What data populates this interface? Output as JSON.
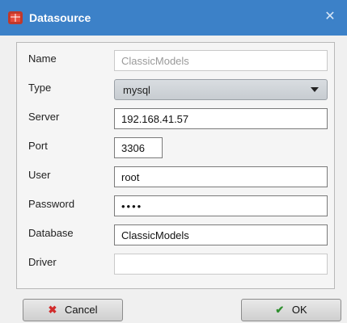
{
  "window": {
    "title": "Datasource"
  },
  "form": {
    "name": {
      "label": "Name",
      "value": "ClassicModels"
    },
    "type": {
      "label": "Type",
      "value": "mysql"
    },
    "server": {
      "label": "Server",
      "value": "192.168.41.57"
    },
    "port": {
      "label": "Port",
      "value": "3306"
    },
    "user": {
      "label": "User",
      "value": "root"
    },
    "password": {
      "label": "Password",
      "value": "••••"
    },
    "database": {
      "label": "Database",
      "value": "ClassicModels"
    },
    "driver": {
      "label": "Driver",
      "value": ""
    }
  },
  "buttons": {
    "cancel": "Cancel",
    "ok": "OK"
  },
  "icons": {
    "app": "database-icon",
    "close": "close-icon",
    "cancel": "cancel-x-icon",
    "ok": "check-icon"
  }
}
